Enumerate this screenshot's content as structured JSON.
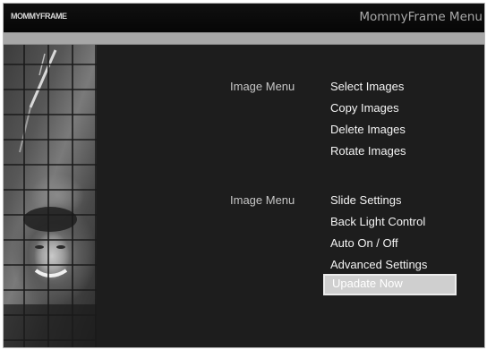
{
  "header": {
    "logo_text": "MOMMYFRAME",
    "menu_title": "MommyFrame Menu"
  },
  "image_menu": {
    "label": "Image Menu",
    "items": [
      "Select Images",
      "Copy Images",
      "Delete Images",
      "Rotate Images"
    ]
  },
  "settings_menu": {
    "label": "Image Menu",
    "items": [
      "Slide Settings",
      "Back Light Control",
      "Auto On / Off",
      "Advanced Settings",
      "Upadate Now"
    ],
    "selected_item": "Upadate Now"
  },
  "colors": {
    "background": "#1d1d1d",
    "title_bar": "#080808",
    "separator": "#a7a7a7",
    "selection": "#cfcfcf",
    "label_text": "#c6c6c6",
    "item_text": "#f4f4f4"
  }
}
